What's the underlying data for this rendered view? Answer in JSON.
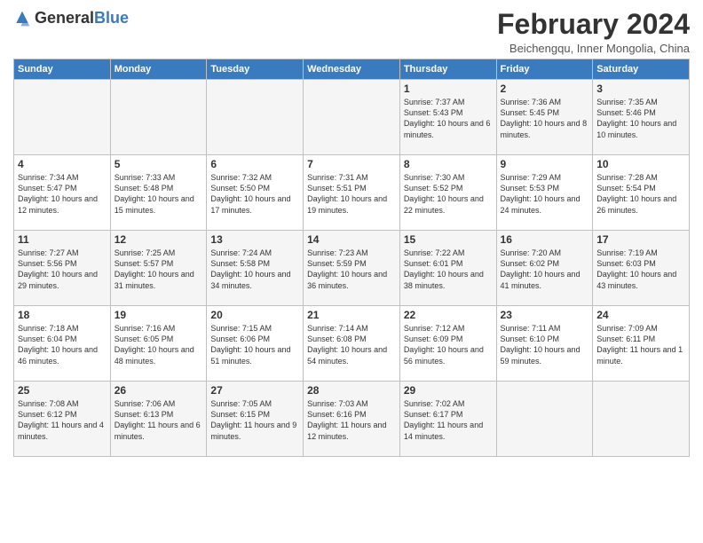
{
  "header": {
    "logo_general": "General",
    "logo_blue": "Blue",
    "title": "February 2024",
    "subtitle": "Beichengqu, Inner Mongolia, China"
  },
  "weekdays": [
    "Sunday",
    "Monday",
    "Tuesday",
    "Wednesday",
    "Thursday",
    "Friday",
    "Saturday"
  ],
  "weeks": [
    [
      {
        "day": "",
        "info": ""
      },
      {
        "day": "",
        "info": ""
      },
      {
        "day": "",
        "info": ""
      },
      {
        "day": "",
        "info": ""
      },
      {
        "day": "1",
        "info": "Sunrise: 7:37 AM\nSunset: 5:43 PM\nDaylight: 10 hours\nand 6 minutes."
      },
      {
        "day": "2",
        "info": "Sunrise: 7:36 AM\nSunset: 5:45 PM\nDaylight: 10 hours\nand 8 minutes."
      },
      {
        "day": "3",
        "info": "Sunrise: 7:35 AM\nSunset: 5:46 PM\nDaylight: 10 hours\nand 10 minutes."
      }
    ],
    [
      {
        "day": "4",
        "info": "Sunrise: 7:34 AM\nSunset: 5:47 PM\nDaylight: 10 hours\nand 12 minutes."
      },
      {
        "day": "5",
        "info": "Sunrise: 7:33 AM\nSunset: 5:48 PM\nDaylight: 10 hours\nand 15 minutes."
      },
      {
        "day": "6",
        "info": "Sunrise: 7:32 AM\nSunset: 5:50 PM\nDaylight: 10 hours\nand 17 minutes."
      },
      {
        "day": "7",
        "info": "Sunrise: 7:31 AM\nSunset: 5:51 PM\nDaylight: 10 hours\nand 19 minutes."
      },
      {
        "day": "8",
        "info": "Sunrise: 7:30 AM\nSunset: 5:52 PM\nDaylight: 10 hours\nand 22 minutes."
      },
      {
        "day": "9",
        "info": "Sunrise: 7:29 AM\nSunset: 5:53 PM\nDaylight: 10 hours\nand 24 minutes."
      },
      {
        "day": "10",
        "info": "Sunrise: 7:28 AM\nSunset: 5:54 PM\nDaylight: 10 hours\nand 26 minutes."
      }
    ],
    [
      {
        "day": "11",
        "info": "Sunrise: 7:27 AM\nSunset: 5:56 PM\nDaylight: 10 hours\nand 29 minutes."
      },
      {
        "day": "12",
        "info": "Sunrise: 7:25 AM\nSunset: 5:57 PM\nDaylight: 10 hours\nand 31 minutes."
      },
      {
        "day": "13",
        "info": "Sunrise: 7:24 AM\nSunset: 5:58 PM\nDaylight: 10 hours\nand 34 minutes."
      },
      {
        "day": "14",
        "info": "Sunrise: 7:23 AM\nSunset: 5:59 PM\nDaylight: 10 hours\nand 36 minutes."
      },
      {
        "day": "15",
        "info": "Sunrise: 7:22 AM\nSunset: 6:01 PM\nDaylight: 10 hours\nand 38 minutes."
      },
      {
        "day": "16",
        "info": "Sunrise: 7:20 AM\nSunset: 6:02 PM\nDaylight: 10 hours\nand 41 minutes."
      },
      {
        "day": "17",
        "info": "Sunrise: 7:19 AM\nSunset: 6:03 PM\nDaylight: 10 hours\nand 43 minutes."
      }
    ],
    [
      {
        "day": "18",
        "info": "Sunrise: 7:18 AM\nSunset: 6:04 PM\nDaylight: 10 hours\nand 46 minutes."
      },
      {
        "day": "19",
        "info": "Sunrise: 7:16 AM\nSunset: 6:05 PM\nDaylight: 10 hours\nand 48 minutes."
      },
      {
        "day": "20",
        "info": "Sunrise: 7:15 AM\nSunset: 6:06 PM\nDaylight: 10 hours\nand 51 minutes."
      },
      {
        "day": "21",
        "info": "Sunrise: 7:14 AM\nSunset: 6:08 PM\nDaylight: 10 hours\nand 54 minutes."
      },
      {
        "day": "22",
        "info": "Sunrise: 7:12 AM\nSunset: 6:09 PM\nDaylight: 10 hours\nand 56 minutes."
      },
      {
        "day": "23",
        "info": "Sunrise: 7:11 AM\nSunset: 6:10 PM\nDaylight: 10 hours\nand 59 minutes."
      },
      {
        "day": "24",
        "info": "Sunrise: 7:09 AM\nSunset: 6:11 PM\nDaylight: 11 hours\nand 1 minute."
      }
    ],
    [
      {
        "day": "25",
        "info": "Sunrise: 7:08 AM\nSunset: 6:12 PM\nDaylight: 11 hours\nand 4 minutes."
      },
      {
        "day": "26",
        "info": "Sunrise: 7:06 AM\nSunset: 6:13 PM\nDaylight: 11 hours\nand 6 minutes."
      },
      {
        "day": "27",
        "info": "Sunrise: 7:05 AM\nSunset: 6:15 PM\nDaylight: 11 hours\nand 9 minutes."
      },
      {
        "day": "28",
        "info": "Sunrise: 7:03 AM\nSunset: 6:16 PM\nDaylight: 11 hours\nand 12 minutes."
      },
      {
        "day": "29",
        "info": "Sunrise: 7:02 AM\nSunset: 6:17 PM\nDaylight: 11 hours\nand 14 minutes."
      },
      {
        "day": "",
        "info": ""
      },
      {
        "day": "",
        "info": ""
      }
    ]
  ]
}
